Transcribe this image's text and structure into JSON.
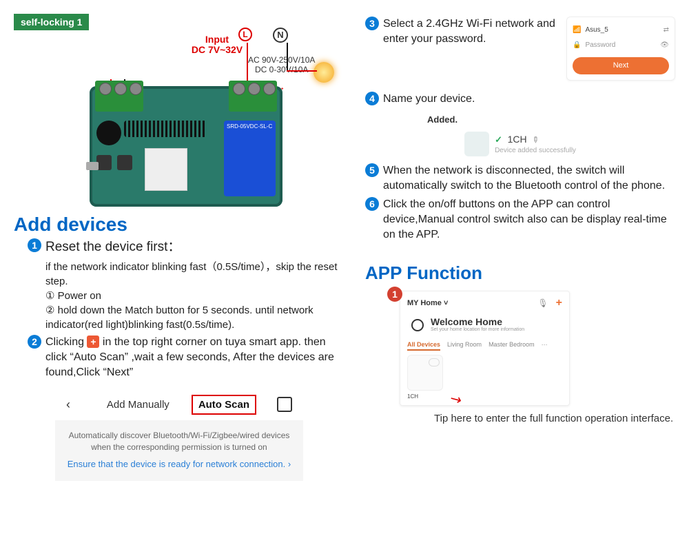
{
  "left": {
    "badge": "self-locking 1",
    "input_label_line1": "Input",
    "input_label_line2": "DC 7V~32V",
    "circuit_L": "L",
    "circuit_N": "N",
    "power_line1": "AC 90V-250V/10A",
    "power_line2": "DC 0-30V/10A",
    "section_title": "Add devices",
    "step1_title": "Reset the device first：",
    "step1_sub1": "if the network indicator blinking fast（0.5S/time），skip the reset step.",
    "step1_sub2_num": "①",
    "step1_sub2": " Power on",
    "step1_sub3_num": "②",
    "step1_sub3": " hold down the Match button for 5 seconds. until  network indicator(red light)blinking fast(0.5s/time).",
    "step2_a": "Clicking ",
    "step2_b": " in the top right corner on tuya smart app. then click “Auto Scan” ,wait a few seconds, After the devices are found,Click “Next”",
    "plus_symbol": "+",
    "app_back": "‹",
    "app_tab_manual": "Add Manually",
    "app_tab_auto": "Auto Scan",
    "app_body_text": "Automatically discover Bluetooth/Wi-Fi/Zigbee/wired devices when the corresponding permission is turned on",
    "app_link_text": "Ensure that the device is ready for network connection.",
    "app_link_chevron": "›"
  },
  "right": {
    "step3": "Select a 2.4GHz Wi-Fi network and enter your password.",
    "wifi_ssid": "Asus_5",
    "wifi_pwd_label": "Password",
    "wifi_next": "Next",
    "step4": "Name your device.",
    "added_title": "Added.",
    "added_check": "✓",
    "added_name": "1CH",
    "added_sub": "Device added successfully",
    "step5": "When the network is disconnected, the switch will automatically switch to the Bluetooth control of the phone.",
    "step6": "Click the on/off buttons on the APP can control device,Manual control switch also can be display real-time on the APP.",
    "section_title2": "APP Function",
    "red_step": "1",
    "home_title_dropdown": "MY Home ˅",
    "mic_icon": "🎤",
    "plus_icon": "+",
    "welcome1": "Welcome Home",
    "welcome2": "Set your home location for more information",
    "tab1": "All Devices",
    "tab2": "Living Room",
    "tab3": "Master Bedroom",
    "tab4": "···",
    "tile_label": "1CH",
    "tip": "Tip here to enter the full function operation interface."
  }
}
